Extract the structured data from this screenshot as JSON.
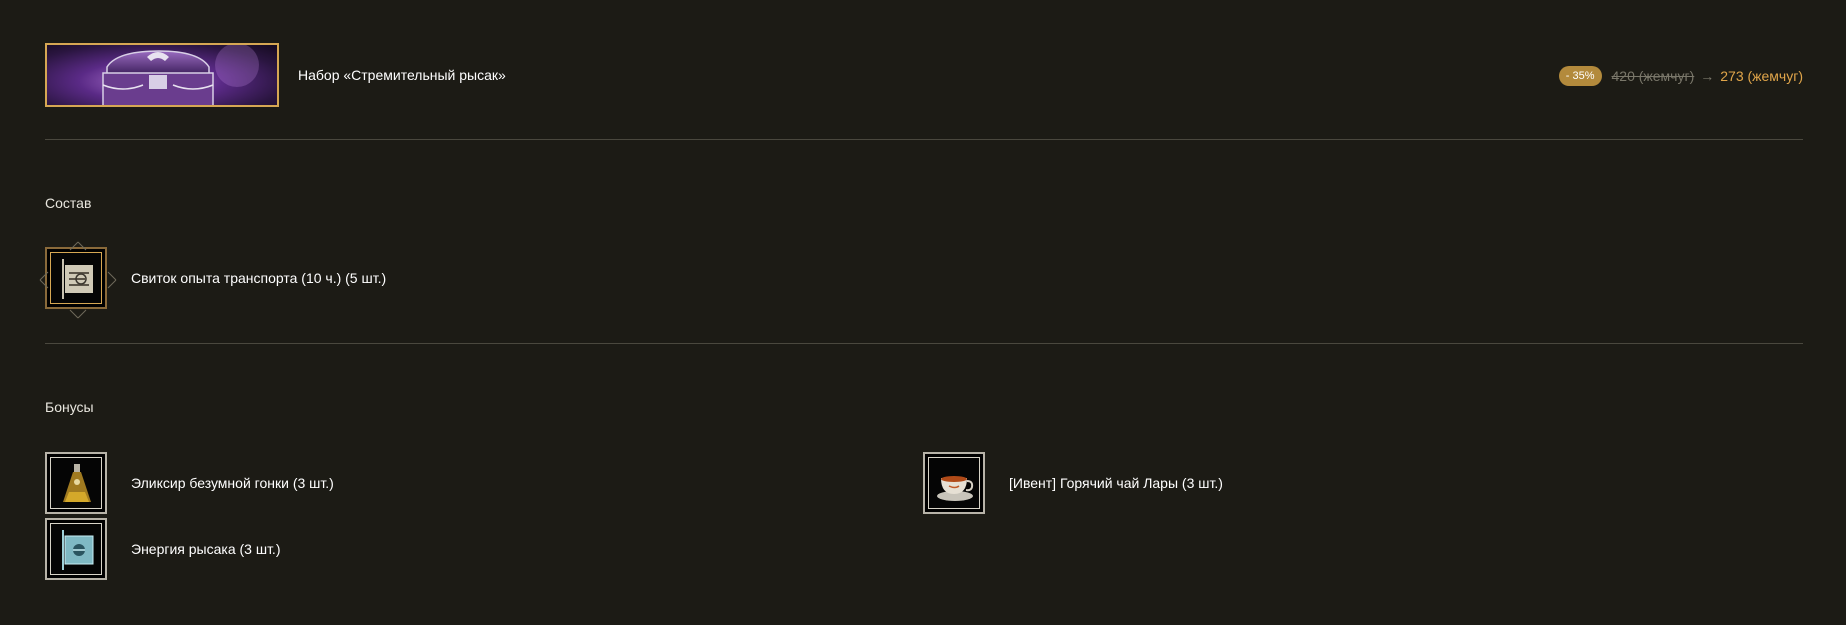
{
  "product": {
    "title": "Набор «Стремительный рысак»",
    "discount_badge": "- 35%",
    "old_price": "420 (жемчуг)",
    "arrow": "→",
    "new_price": "273 (жемчуг)"
  },
  "composition": {
    "heading": "Состав",
    "items": [
      {
        "label": "Свиток опыта транспорта (10 ч.) (5 шт.)",
        "icon": "scroll-icon"
      }
    ]
  },
  "bonuses": {
    "heading": "Бонусы",
    "items": [
      {
        "label": "Эликсир безумной гонки (3 шт.)",
        "icon": "elixir-icon"
      },
      {
        "label": "[Ивент] Горячий чай Лары (3 шт.)",
        "icon": "tea-cup-icon"
      },
      {
        "label": "Энергия рысака (3 шт.)",
        "icon": "energy-scroll-icon"
      }
    ]
  },
  "colors": {
    "background": "#1c1b15",
    "accent_gold": "#d6a753",
    "new_price": "#e0a54a",
    "divider": "#4a483e"
  }
}
